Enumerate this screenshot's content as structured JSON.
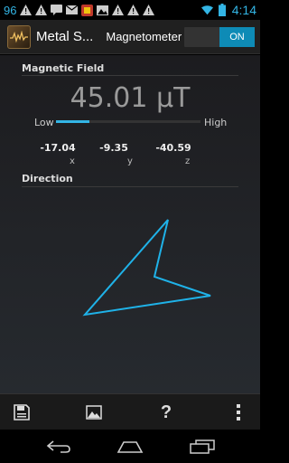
{
  "status_bar": {
    "left_number": "96",
    "time": "4:14"
  },
  "action_bar": {
    "app_title": "Metal S...",
    "mode": "Magnetometer",
    "toggle": "ON"
  },
  "magnetic_field": {
    "title": "Magnetic Field",
    "value": "45.01 μT",
    "low_label": "Low",
    "high_label": "High",
    "level_fraction": 0.23,
    "axes": [
      {
        "value": "-17.04",
        "label": "x"
      },
      {
        "value": "-9.35",
        "label": "y"
      },
      {
        "value": "-40.59",
        "label": "z"
      }
    ]
  },
  "direction": {
    "title": "Direction",
    "arrow_color": "#1fb2e8"
  },
  "toolbar": {
    "help": "?"
  },
  "colors": {
    "accent": "#33b5e5"
  }
}
